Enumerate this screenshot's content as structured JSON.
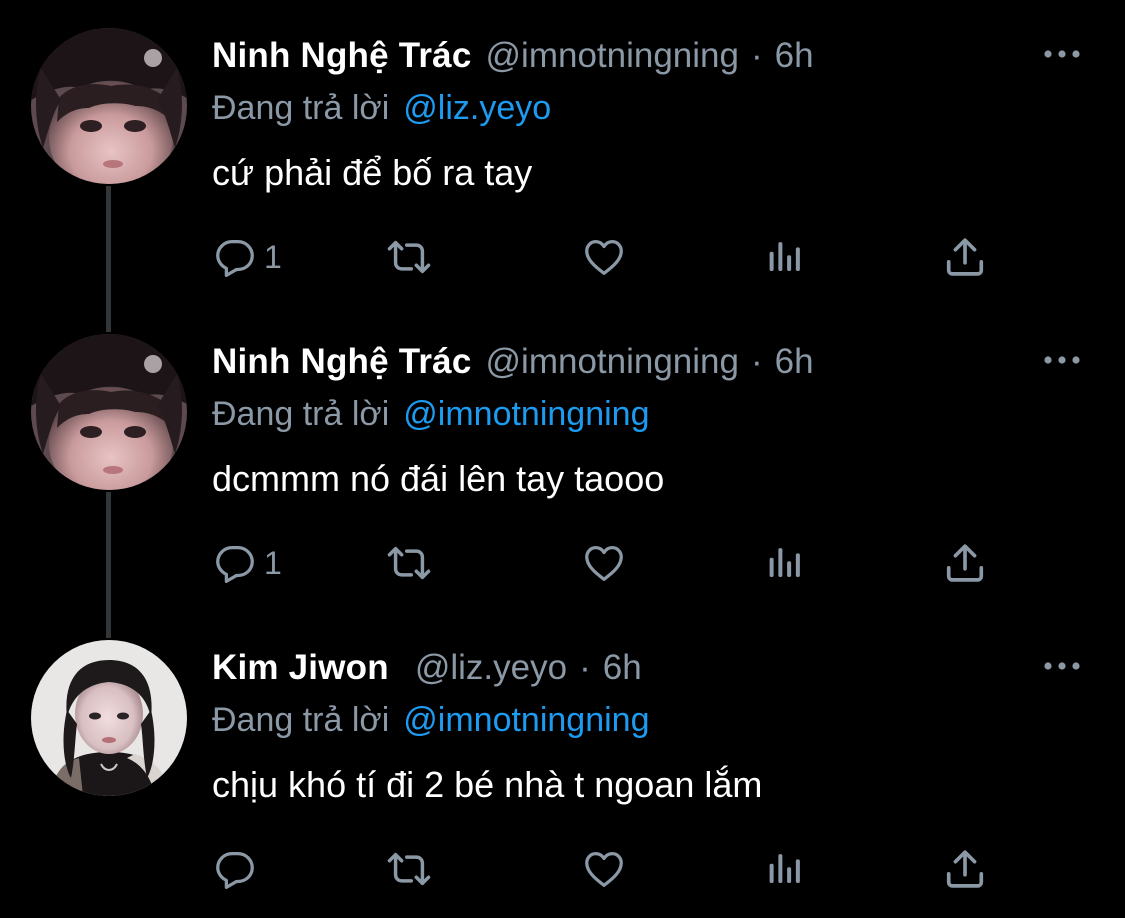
{
  "colors": {
    "background": "#000000",
    "text": "#ffffff",
    "secondary": "#8b98a5",
    "accent": "#1d9bf0",
    "thread_line": "#333639"
  },
  "icons": [
    "more-icon",
    "reply-icon",
    "retweet-icon",
    "like-icon",
    "views-icon",
    "share-icon"
  ],
  "tweets": [
    {
      "name": "Ninh Nghệ Trác",
      "handle": "@imnotningning",
      "separator": "·",
      "time": "6h",
      "replying_label": "Đang trả lời",
      "replying_to": "@liz.yeyo",
      "text": "cứ phải để bố ra tay",
      "reply_count": "1"
    },
    {
      "name": "Ninh Nghệ Trác",
      "handle": "@imnotningning",
      "separator": "·",
      "time": "6h",
      "replying_label": "Đang trả lời",
      "replying_to": "@imnotningning",
      "text": "dcmmm nó đái lên tay taooo",
      "reply_count": "1"
    },
    {
      "name": "Kim Jiwon",
      "handle": "@liz.yeyo",
      "separator": "·",
      "time": "6h",
      "replying_label": "Đang trả lời",
      "replying_to": "@imnotningning",
      "text": "chịu khó tí đi 2 bé nhà t ngoan lắm",
      "reply_count": ""
    }
  ]
}
